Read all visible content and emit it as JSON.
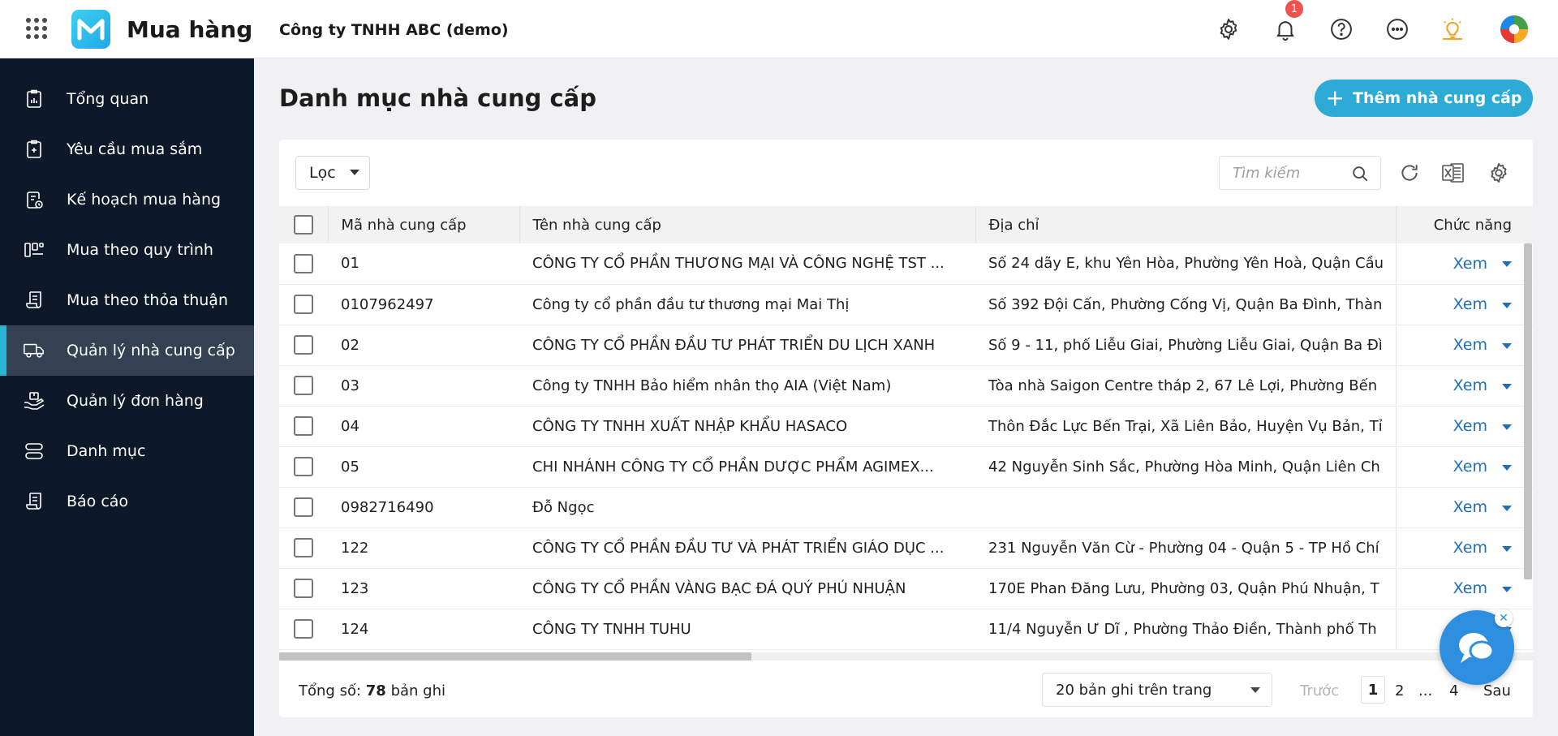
{
  "header": {
    "app_name": "Mua hàng",
    "company": "Công ty TNHH ABC (demo)",
    "notification_count": "1",
    "icons": [
      "apps-grid-icon",
      "settings-icon",
      "bell-icon",
      "help-icon",
      "more-icon",
      "lightbulb-icon",
      "user-avatar-icon"
    ]
  },
  "sidebar": {
    "items": [
      {
        "label": "Tổng quan",
        "icon": "dashboard-icon"
      },
      {
        "label": "Yêu cầu mua sắm",
        "icon": "request-icon"
      },
      {
        "label": "Kế hoạch mua hàng",
        "icon": "plan-icon"
      },
      {
        "label": "Mua theo quy trình",
        "icon": "process-icon"
      },
      {
        "label": "Mua theo thỏa thuận",
        "icon": "agreement-icon"
      },
      {
        "label": "Quản lý nhà cung cấp",
        "icon": "truck-icon",
        "active": true
      },
      {
        "label": "Quản lý đơn hàng",
        "icon": "orders-icon"
      },
      {
        "label": "Danh mục",
        "icon": "category-icon"
      },
      {
        "label": "Báo cáo",
        "icon": "report-icon"
      }
    ]
  },
  "main": {
    "title": "Danh mục nhà cung cấp",
    "add_button": "Thêm nhà cung cấp",
    "filter_label": "Lọc",
    "search_placeholder": "Tìm kiếm",
    "columns": [
      "Mã nhà cung cấp",
      "Tên nhà cung cấp",
      "Địa chỉ",
      "Chức năng"
    ],
    "action_label": "Xem",
    "rows": [
      {
        "code": "01",
        "name": "CÔNG TY CỔ PHẦN THƯƠNG MẠI VÀ CÔNG NGHỆ TST ...",
        "address": "Số 24 dãy E, khu Yên Hòa, Phường Yên Hoà, Quận Cầu"
      },
      {
        "code": "0107962497",
        "name": "Công ty cổ phần đầu tư thương mại Mai Thị",
        "address": "Số 392 Đội Cấn, Phường Cống Vị, Quận Ba Đình, Thàn"
      },
      {
        "code": "02",
        "name": "CÔNG TY CỔ PHẦN ĐẦU TƯ PHÁT TRIỂN DU LỊCH XANH",
        "address": "Số 9 - 11, phố Liễu Giai, Phường Liễu Giai, Quận Ba Đì"
      },
      {
        "code": "03",
        "name": "Công ty TNHH Bảo hiểm nhân thọ AIA (Việt Nam)",
        "address": "Tòa nhà Saigon Centre tháp 2, 67 Lê Lợi, Phường Bến"
      },
      {
        "code": "04",
        "name": "CÔNG TY TNHH XUẤT NHẬP KHẨU HASACO",
        "address": "Thôn Đắc Lực Bến Trại, Xã Liên Bảo, Huyện Vụ Bản, Tỉ"
      },
      {
        "code": "05",
        "name": "CHI NHÁNH CÔNG TY CỔ PHẦN DƯỢC PHẨM AGIMEX...",
        "address": "42 Nguyễn Sinh Sắc, Phường Hòa Minh, Quận Liên Ch"
      },
      {
        "code": "0982716490",
        "name": "Đỗ Ngọc",
        "address": ""
      },
      {
        "code": "122",
        "name": "CÔNG TY CỔ PHẦN ĐẦU TƯ VÀ PHÁT TRIỂN GIÁO DỤC ...",
        "address": "231 Nguyễn Văn Cừ - Phường 04 - Quận 5 - TP Hồ Chí"
      },
      {
        "code": "123",
        "name": "CÔNG TY CỔ PHẦN VÀNG BẠC ĐÁ QUÝ PHÚ NHUẬN",
        "address": "170E Phan Đăng Lưu, Phường 03, Quận Phú Nhuận, T"
      },
      {
        "code": "124",
        "name": "CÔNG TY TNHH TUHU",
        "address": "11/4 Nguyễn Ư Dĩ , Phường Thảo Điền, Thành phố Th"
      }
    ],
    "footer": {
      "total_prefix": "Tổng số:",
      "total_count": "78",
      "total_suffix": "bản ghi",
      "per_page": "20 bản ghi trên trang",
      "prev": "Trước",
      "pages": [
        "1",
        "2",
        "...",
        "4"
      ],
      "next": "Sau"
    }
  },
  "colors": {
    "sidebar_bg": "#0d1828",
    "sidebar_active": "#344152",
    "accent": "#2eaad6",
    "link": "#1e6fb8",
    "badge": "#ef5350"
  }
}
